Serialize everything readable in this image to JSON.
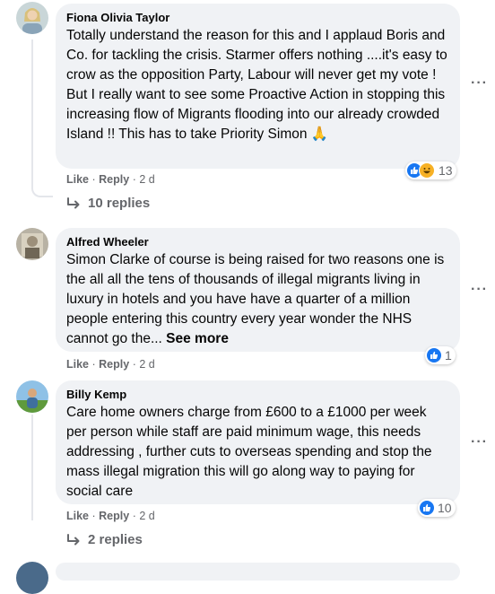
{
  "comments": [
    {
      "author": "Fiona Olivia Taylor",
      "text": "Totally understand the reason for this and I applaud Boris and Co. for tackling the crisis. Starmer offers nothing ....it's easy to crow as the opposition Party, Labour will never get my vote ! But I really want to see some Proactive Action in stopping this increasing flow of Migrants flooding into our already crowded Island !! This has to take Priority Simon 🙏",
      "like": "Like",
      "reply": "Reply",
      "time": "2 d",
      "reaction_count": "13",
      "replies_label": "10 replies",
      "reactions": [
        "like-icon",
        "haha-icon"
      ]
    },
    {
      "author": "Alfred Wheeler",
      "text": "Simon Clarke of course is being raised for two reasons one is the all all the tens of thousands of illegal migrants living in luxury in hotels and you have have a quarter of a million people entering this country every year wonder the NHS cannot go the... ",
      "see_more": "See more",
      "like": "Like",
      "reply": "Reply",
      "time": "2 d",
      "reaction_count": "1",
      "reactions": [
        "like-icon"
      ]
    },
    {
      "author": "Billy Kemp",
      "text": "Care home owners charge from £600 to a £1000 per week per person while staff are paid minimum wage, this needs addressing , further cuts to overseas spending and stop the mass illegal migration this will go along way to paying for social care",
      "like": "Like",
      "reply": "Reply",
      "time": "2 d",
      "reaction_count": "10",
      "replies_label": "2 replies",
      "reactions": [
        "like-icon"
      ]
    }
  ],
  "separator": "·",
  "more_glyph": "···",
  "colors": {
    "bubble": "#f0f2f5",
    "like_blue": "#1877f2",
    "haha_yellow": "#f7b125",
    "meta_grey": "#65676b"
  }
}
